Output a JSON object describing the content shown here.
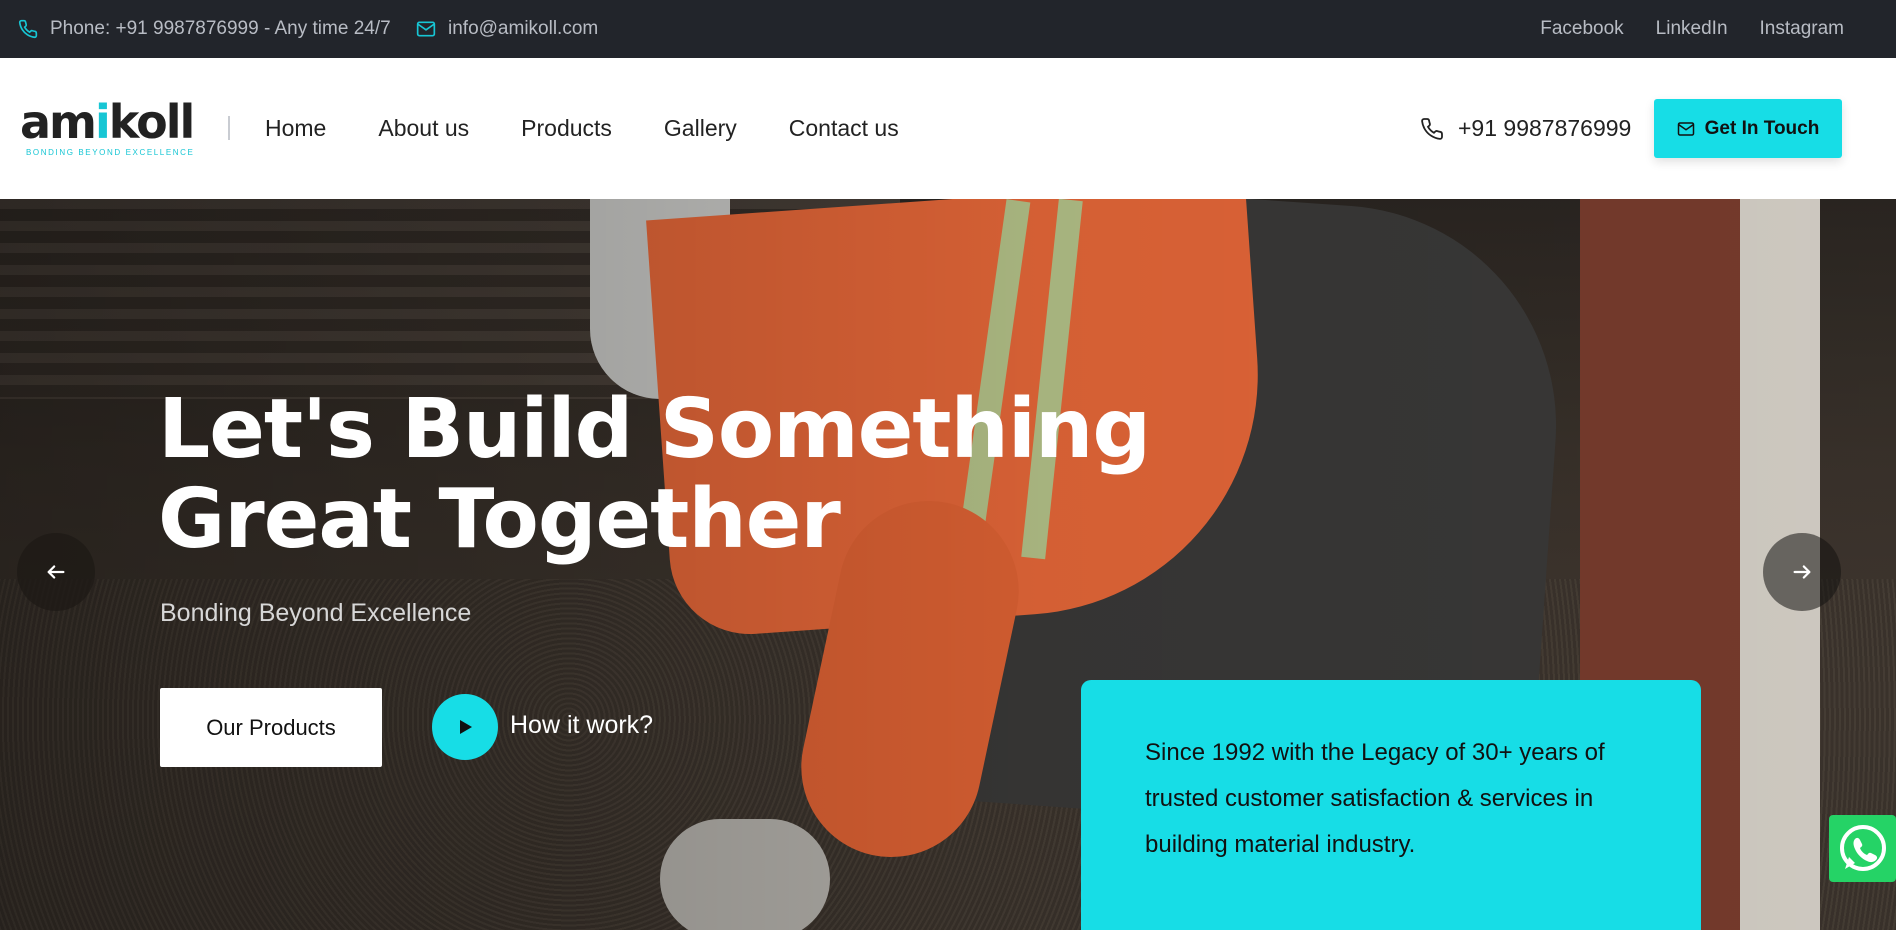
{
  "topbar": {
    "phone_text": "Phone: +91 9987876999 - Any time 24/7",
    "email_text": "info@amikoll.com",
    "social": [
      "Facebook",
      "LinkedIn",
      "Instagram"
    ]
  },
  "header": {
    "logo_text_pre": "am",
    "logo_text_i": "i",
    "logo_text_post": "koll",
    "logo_tagline": "BONDING BEYOND EXCELLENCE",
    "nav": [
      "Home",
      "About us",
      "Products",
      "Gallery",
      "Contact us"
    ],
    "phone": "+91 9987876999",
    "cta_label": "Get In Touch"
  },
  "hero": {
    "title_line1": "Let's Build Something",
    "title_line2": "Great Together",
    "subtitle": "Bonding Beyond Excellence",
    "products_button": "Our Products",
    "how_label": "How it work?",
    "legacy_text": "Since 1992 with the Legacy of 30+ years of trusted customer satisfaction & services in building material industry."
  },
  "colors": {
    "accent": "#17dde6",
    "topbar_bg": "#22252b",
    "whatsapp": "#25d366"
  }
}
